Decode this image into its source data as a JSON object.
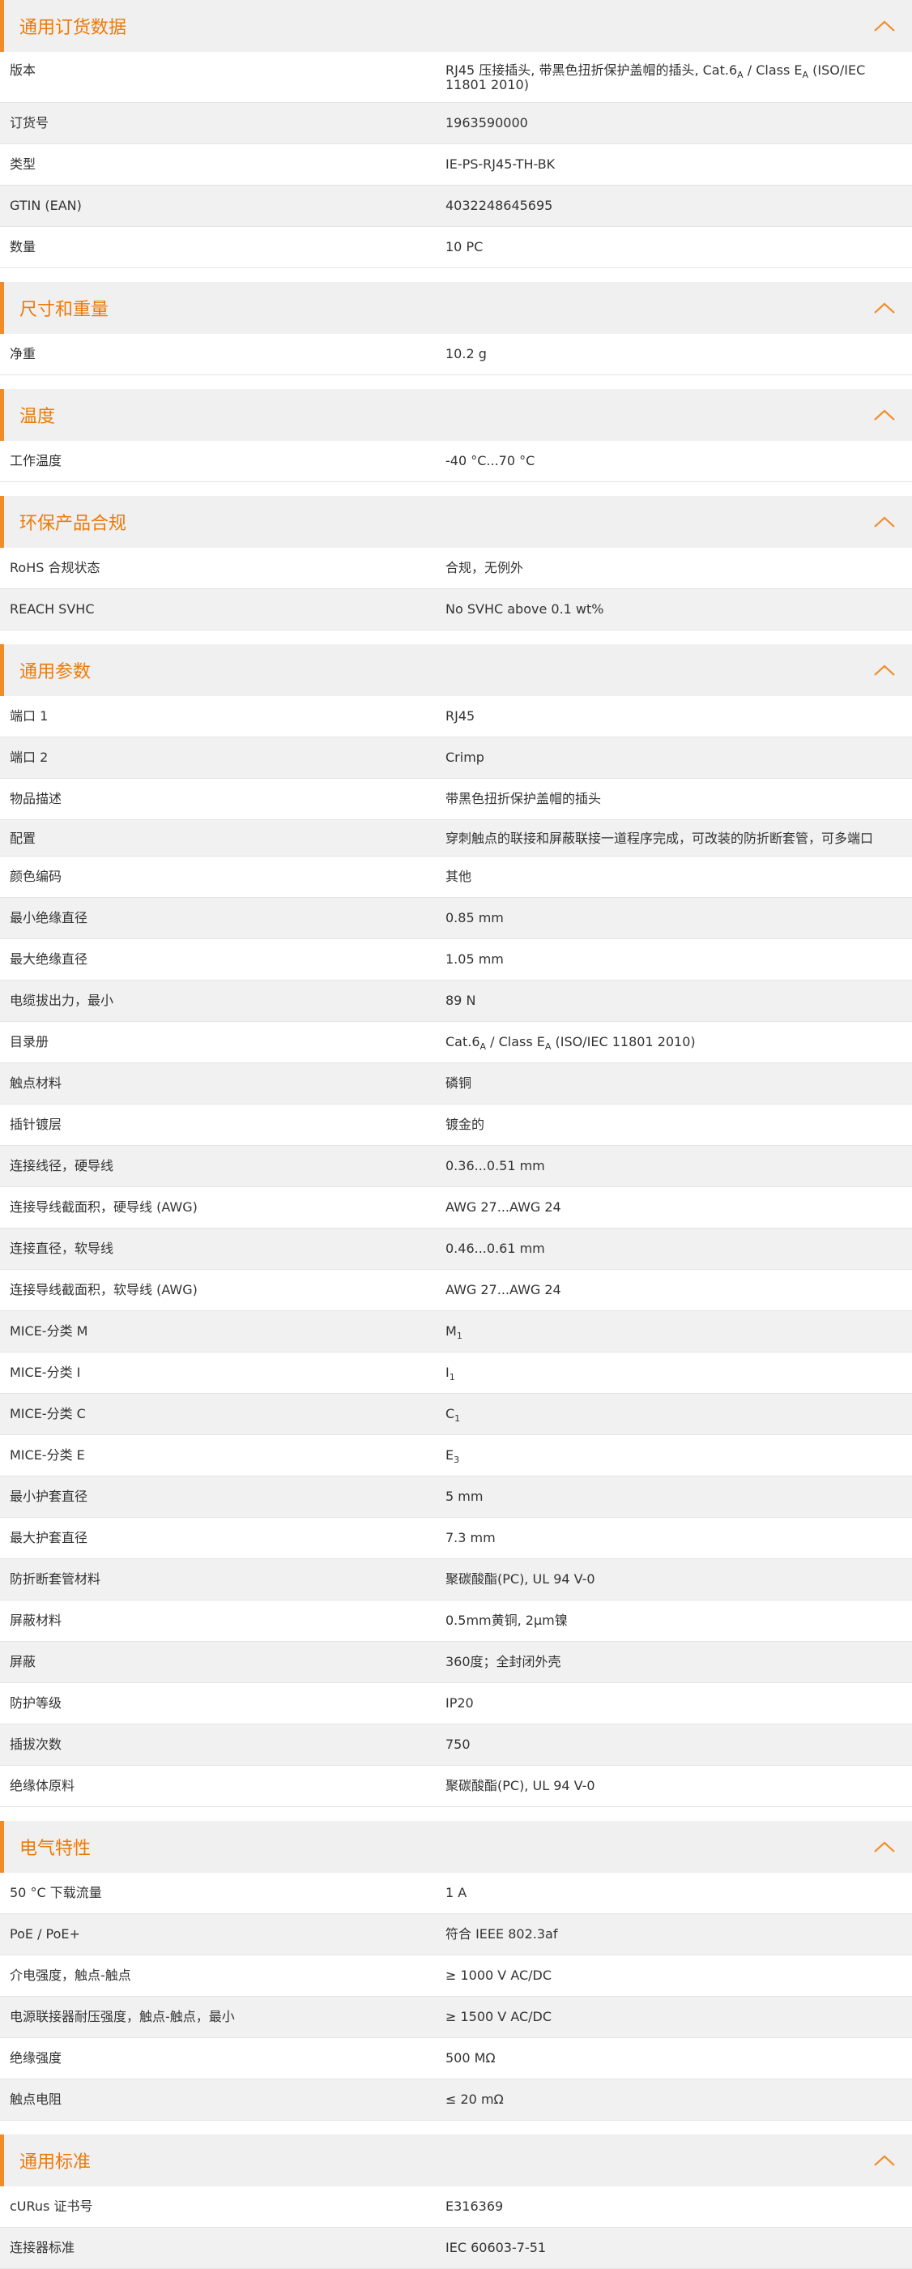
{
  "sections": [
    {
      "title": "通用订货数据",
      "rows": [
        {
          "label": "版本",
          "value": "RJ45 压接插头, 带黑色扭折保护盖帽的插头, Cat.6A / Class EA (ISO/IEC 11801 2010)",
          "tall": true
        },
        {
          "label": "订货号",
          "value": "1963590000"
        },
        {
          "label": "类型",
          "value": "IE-PS-RJ45-TH-BK"
        },
        {
          "label": "GTIN (EAN)",
          "value": "4032248645695"
        },
        {
          "label": "数量",
          "value": "10  PC"
        }
      ]
    },
    {
      "title": "尺寸和重量",
      "rows": [
        {
          "label": "净重",
          "value": "10.2  g"
        }
      ]
    },
    {
      "title": "温度",
      "rows": [
        {
          "label": "工作温度",
          "value": "-40 °C...70 °C"
        }
      ]
    },
    {
      "title": "环保产品合规",
      "rows": [
        {
          "label": "RoHS 合规状态",
          "value": "合规，无例外"
        },
        {
          "label": "REACH SVHC",
          "value": "No SVHC above 0.1 wt%"
        }
      ]
    },
    {
      "title": "通用参数",
      "rows": [
        {
          "label": "端口 1",
          "value": "RJ45"
        },
        {
          "label": "端口 2",
          "value": "Crimp"
        },
        {
          "label": "物品描述",
          "value": "带黑色扭折保护盖帽的插头"
        },
        {
          "label": "配置",
          "value": "穿刺触点的联接和屏蔽联接一道程序完成，可改装的防折断套管，可多端口",
          "tall": true
        },
        {
          "label": "颜色编码",
          "value": "其他"
        },
        {
          "label": "最小绝缘直径",
          "value": "0.85  mm"
        },
        {
          "label": "最大绝缘直径",
          "value": "1.05  mm"
        },
        {
          "label": "电缆拔出力，最小",
          "value": "89  N"
        },
        {
          "label": "目录册",
          "value": "Cat.6A / Class EA (ISO/IEC 11801 2010)"
        },
        {
          "label": "触点材料",
          "value": "磷铜"
        },
        {
          "label": "插针镀层",
          "value": "镀金的"
        },
        {
          "label": "连接线径，硬导线",
          "value": "0.36...0.51 mm"
        },
        {
          "label": "连接导线截面积，硬导线 (AWG)",
          "value": "AWG 27...AWG 24"
        },
        {
          "label": "连接直径，软导线",
          "value": "0.46...0.61 mm"
        },
        {
          "label": "连接导线截面积，软导线 (AWG)",
          "value": "AWG 27...AWG 24"
        },
        {
          "label": "MICE-分类 M",
          "value": "M1"
        },
        {
          "label": "MICE-分类 I",
          "value": "I1"
        },
        {
          "label": "MICE-分类 C",
          "value": "C1"
        },
        {
          "label": "MICE-分类 E",
          "value": "E3"
        },
        {
          "label": "最小护套直径",
          "value": "5  mm"
        },
        {
          "label": "最大护套直径",
          "value": "7.3  mm"
        },
        {
          "label": "防折断套管材料",
          "value": "聚碳酸酯(PC), UL 94 V-0"
        },
        {
          "label": "屏蔽材料",
          "value": "0.5mm黄铜, 2μm镍"
        },
        {
          "label": "屏蔽",
          "value": "360度；全封闭外壳"
        },
        {
          "label": "防护等级",
          "value": "IP20"
        },
        {
          "label": "插拔次数",
          "value": "750"
        },
        {
          "label": "绝缘体原料",
          "value": "聚碳酸酯(PC), UL 94 V-0"
        }
      ]
    },
    {
      "title": "电气特性",
      "rows": [
        {
          "label": "50 °C 下载流量",
          "value": "1  A"
        },
        {
          "label": "PoE / PoE+",
          "value": "符合 IEEE 802.3af"
        },
        {
          "label": "介电强度，触点-触点",
          "value": "≥ 1000 V AC/DC"
        },
        {
          "label": "电源联接器耐压强度，触点-触点，最小",
          "value": "≥ 1500 V AC/DC"
        },
        {
          "label": "绝缘强度",
          "value": "500 MΩ"
        },
        {
          "label": "触点电阻",
          "value": "≤ 20 mΩ"
        }
      ]
    },
    {
      "title": "通用标准",
      "rows": [
        {
          "label": "cURus 证书号",
          "value": "E316369"
        },
        {
          "label": "连接器标准",
          "value": "IEC 60603-7-51"
        }
      ]
    }
  ],
  "icons": {
    "collapse": "chevron-up-icon"
  },
  "colors": {
    "accent": "#f28c28",
    "title": "#ec7a08",
    "header_bg": "#f0f0f0",
    "row_alt_bg": "#f1f1f1"
  }
}
